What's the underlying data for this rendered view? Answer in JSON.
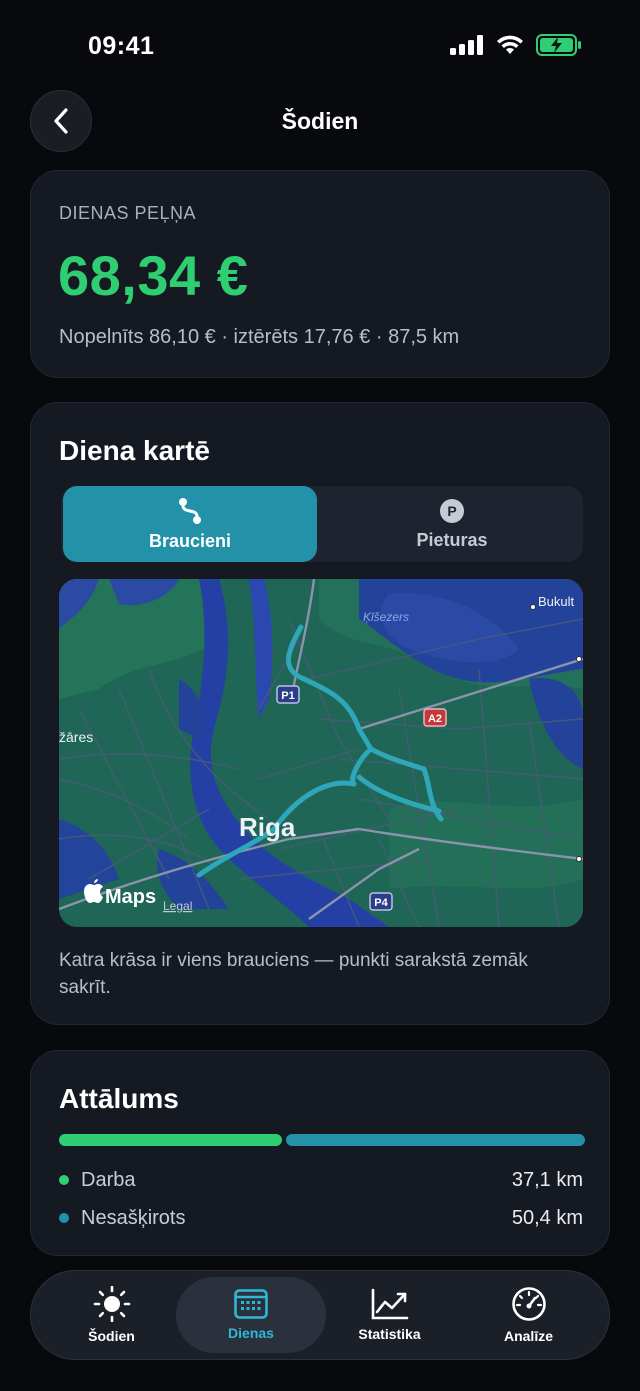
{
  "status_bar": {
    "time": "09:41"
  },
  "header": {
    "title": "Šodien"
  },
  "profit_card": {
    "label": "DIENAS PEĻŅA",
    "value": "68,34 €",
    "summary": "Nopelnīts 86,10 € · iztērēts 17,76 € · 87,5 km"
  },
  "map_card": {
    "title": "Diena kartē",
    "segments": [
      {
        "label": "Braucieni",
        "icon": "route-icon",
        "selected": true
      },
      {
        "label": "Pieturas",
        "icon": "parking-icon",
        "selected": false
      }
    ],
    "map": {
      "labels": {
        "city": "Riga",
        "lake": "Ķīšezers",
        "place_top_right": "Bukult",
        "place_left": "žāres",
        "road_p1": "P1",
        "road_a2": "A2",
        "road_p4": "P4",
        "maps_brand": "Maps",
        "legal": "Legal"
      },
      "route_color": "#2fa7b8"
    },
    "caption": "Katra krāsa ir viens brauciens — punkti sarakstā zemāk sakrīt."
  },
  "distance_card": {
    "title": "Attālums",
    "work_fraction": 0.424,
    "items": [
      {
        "label": "Darba",
        "value": "37,1 km",
        "color": "#2fce72"
      },
      {
        "label": "Nesašķirots",
        "value": "50,4 km",
        "color": "#2391a8"
      }
    ]
  },
  "tab_bar": {
    "tabs": [
      {
        "label": "Šodien",
        "icon": "sun-icon",
        "active": false
      },
      {
        "label": "Dienas",
        "icon": "calendar-icon",
        "active": true
      },
      {
        "label": "Statistika",
        "icon": "chart-icon",
        "active": false
      },
      {
        "label": "Analīze",
        "icon": "speedometer-icon",
        "active": false
      }
    ]
  },
  "watermark": "Braucieni",
  "colors": {
    "background": "#07090d",
    "card": "#151922",
    "accent_green": "#2fce72",
    "accent_teal": "#2391a8"
  }
}
